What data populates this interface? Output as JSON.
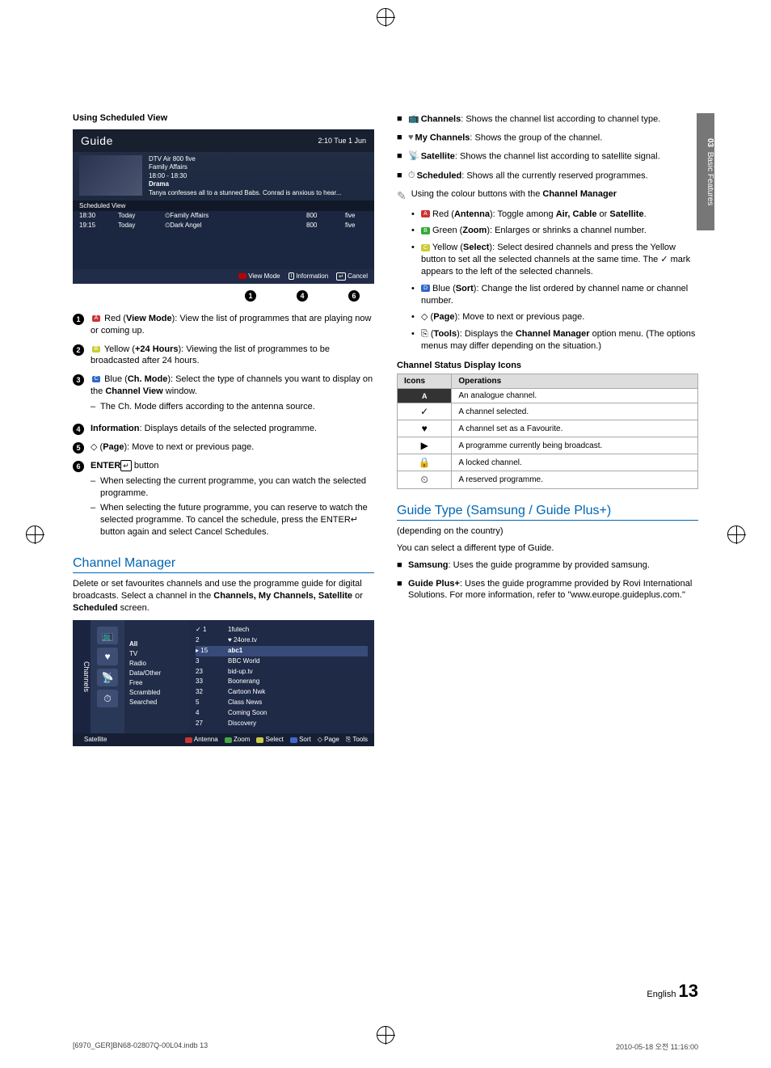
{
  "page": {
    "section_header": "Using Scheduled View",
    "sidetab": {
      "num": "03",
      "label": "Basic Features"
    },
    "footer_lang": "English",
    "footer_page": "13",
    "print_file": "[6970_GER]BN68-02807Q-00L04.indb   13",
    "print_time": "2010-05-18   오전 11:16:00"
  },
  "guide": {
    "title": "Guide",
    "clock": "2:10 Tue 1 Jun",
    "meta_line1": "DTV Air 800 five",
    "meta_line2": "Family Affairs",
    "meta_line3": "18:00 - 18:30",
    "meta_tag": "Drama",
    "meta_desc": "Tanya confesses all to a stunned Babs. Conrad is anxious to hear...",
    "subhead": "Scheduled View",
    "rows": [
      {
        "t": "18:30",
        "d": "Today",
        "p": "Family Affairs",
        "n": "800",
        "c": "five",
        "clock": true
      },
      {
        "t": "19:15",
        "d": "Today",
        "p": "Dark Angel",
        "n": "800",
        "c": "five",
        "clock": true
      }
    ],
    "foot_view": "View Mode",
    "foot_info": "Information",
    "foot_cancel": "Cancel"
  },
  "callouts": {
    "a": "1",
    "b": "4",
    "c": "6"
  },
  "items": [
    {
      "n": "1",
      "pre": "Red (",
      "k": "View Mode",
      "txt": "): View the list of programmes that are playing now or coming up."
    },
    {
      "n": "2",
      "pre": "Yellow (",
      "k": "+24 Hours",
      "txt": "): Viewing the list of programmes to be broadcasted after 24 hours."
    },
    {
      "n": "3",
      "pre": "Blue (",
      "k": "Ch. Mode",
      "txt": "): Select the type of channels you want to display on the ",
      "k2": "Channel View",
      "txt2": " window.",
      "sub": [
        "The Ch. Mode differs according to the antenna source."
      ]
    },
    {
      "n": "4",
      "k": "Information",
      "txt": ": Displays details of the selected programme."
    },
    {
      "n": "5",
      "p": "◇ (",
      "k": "Page",
      "txt": "): Move to next or previous page."
    },
    {
      "n": "6",
      "k": "ENTER",
      "e": "↵",
      "txt": " button",
      "sub": [
        "When selecting the current programme, you can watch the selected programme.",
        "When selecting the future programme, you can reserve to watch the selected programme. To cancel the schedule, press the ENTER↵ button again and select Cancel Schedules."
      ]
    }
  ],
  "chmgr": {
    "heading": "Channel Manager",
    "intro": "Delete or set favourites channels and use the programme guide for digital broadcasts. Select a channel in the ",
    "intro_b": "Channels, My Channels, Satellite",
    "intro_or": " or ",
    "intro_b2": "Scheduled",
    "intro_end": " screen.",
    "side": "Channels",
    "filter_head": "All",
    "filters": [
      "TV",
      "Radio",
      "Data/Other",
      "Free",
      "Scrambled",
      "Searched"
    ],
    "chk": "✓",
    "rows": [
      {
        "n": "1",
        "name": "1futech",
        "chk": true
      },
      {
        "n": "2",
        "name": "24ore.tv",
        "heart": true
      },
      {
        "n": "15",
        "name": "abc1",
        "hi": true
      },
      {
        "n": "3",
        "name": "BBC World"
      },
      {
        "n": "23",
        "name": "bid-up.tv"
      },
      {
        "n": "33",
        "name": "Boonerang"
      },
      {
        "n": "32",
        "name": "Cartoon Nwk"
      },
      {
        "n": "5",
        "name": "Class News"
      },
      {
        "n": "4",
        "name": "Coming Soon"
      },
      {
        "n": "27",
        "name": "Discovery"
      }
    ],
    "foot_src": "Satellite",
    "foot": {
      "antenna": "Antenna",
      "zoom": "Zoom",
      "select": "Select",
      "sort": "Sort",
      "page": "Page",
      "tools": "Tools"
    }
  },
  "right": {
    "bullets": [
      {
        "ic": "📺",
        "b": "Channels",
        "t": ": Shows the channel list according to channel type."
      },
      {
        "ic": "♥",
        "b": "My Channels",
        "t": ": Shows the group of the channel."
      },
      {
        "ic": "📡",
        "b": "Satellite",
        "t": ": Shows the channel list according to satellite signal."
      },
      {
        "ic": "⏱",
        "b": "Scheduled",
        "t": ": Shows all the currently reserved programmes."
      }
    ],
    "note": "Using the colour buttons with the ",
    "note_b": "Channel Manager",
    "colour": [
      {
        "c": "r",
        "lbl": "A",
        "b": "Antenna",
        "t": "Toggle among ",
        "b2": "Air, Cable",
        "t2": " or ",
        "b3": "Satellite",
        "t3": "."
      },
      {
        "c": "g",
        "lbl": "B",
        "b": "Zoom",
        "t": "Enlarges or shrinks a channel number."
      },
      {
        "c": "y",
        "lbl": "C",
        "b": "Select",
        "t": "Select desired channels and press the Yellow button to set all the selected channels at the same time. The ✓ mark appears to the left of the selected channels."
      },
      {
        "c": "b",
        "lbl": "D",
        "b": "Sort",
        "t": "Change the list ordered by channel name or channel number."
      }
    ],
    "extra": [
      {
        "sym": "◇",
        "b": "Page",
        "t": "Move to next or previous page."
      },
      {
        "sym": "⎘",
        "b": "Tools",
        "t": "Displays the ",
        "b2": "Channel Manager",
        "t2": " option menu. (The options menus may differ depending on the situation.)"
      }
    ],
    "tbl_head": "Channel Status Display Icons",
    "tbl_cols": {
      "a": "Icons",
      "b": "Operations"
    },
    "tbl": [
      {
        "i": "A",
        "t": "An analogue channel."
      },
      {
        "i": "✓",
        "t": "A channel selected."
      },
      {
        "i": "♥",
        "t": "A channel set as a Favourite."
      },
      {
        "i": "▶",
        "t": "A programme currently being broadcast."
      },
      {
        "i": "🔒",
        "t": "A locked channel."
      },
      {
        "i": "⏲",
        "t": "A reserved programme."
      }
    ],
    "guide_type_h": "Guide Type (Samsung / Guide Plus+)",
    "gt_dep": "(depending on the country)",
    "gt_p": "You can select a different type of Guide.",
    "gt": [
      {
        "b": "Samsung",
        "t": ": Uses the guide programme by provided samsung."
      },
      {
        "b": "Guide Plus+",
        "t": ": Uses the guide programme provided by Rovi International Solutions. For more information, refer to \"www.europe.guideplus.com.\""
      }
    ]
  }
}
